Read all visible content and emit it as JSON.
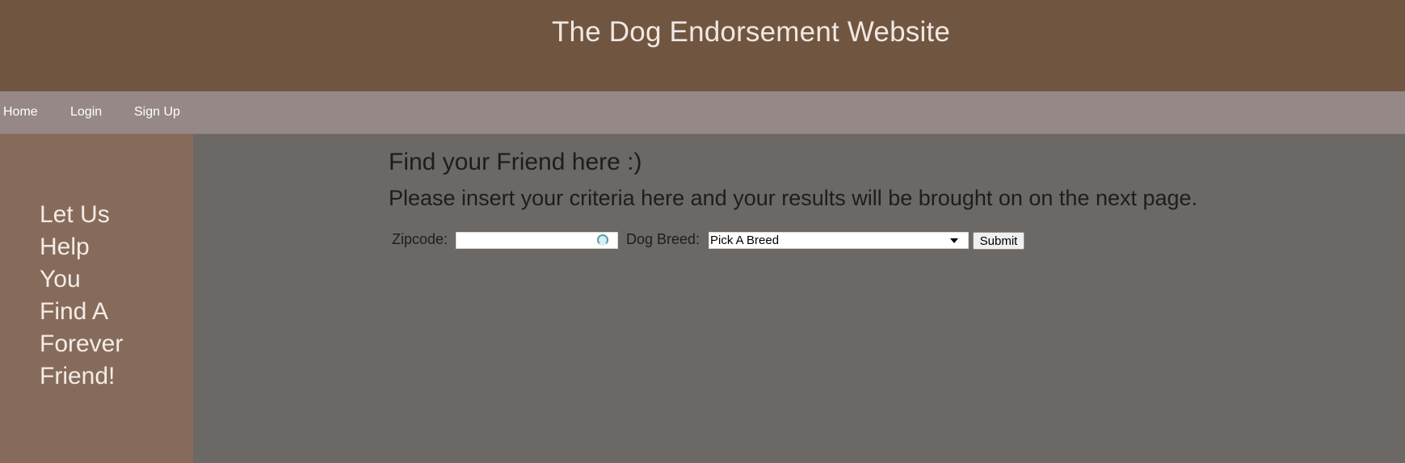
{
  "header": {
    "title": "The Dog Endorsement Website"
  },
  "nav": {
    "items": [
      {
        "label": "Home"
      },
      {
        "label": "Login"
      },
      {
        "label": "Sign Up"
      }
    ]
  },
  "sidebar": {
    "lines": [
      "Let Us",
      "Help",
      "You",
      "Find A",
      "Forever",
      "Friend!"
    ]
  },
  "main": {
    "heading": "Find your Friend here :)",
    "subheading": "Please insert your criteria here and your results will be brought on on the next page."
  },
  "search_form": {
    "zipcode_label": "Zipcode:",
    "zipcode_value": "",
    "breed_label": "Dog Breed:",
    "breed_selected": "Pick A Breed",
    "submit_label": "Submit"
  },
  "colors": {
    "header_bg": "#705640",
    "nav_bg": "#958887",
    "sidebar_bg": "#876b5a",
    "main_bg": "#6b6865"
  }
}
